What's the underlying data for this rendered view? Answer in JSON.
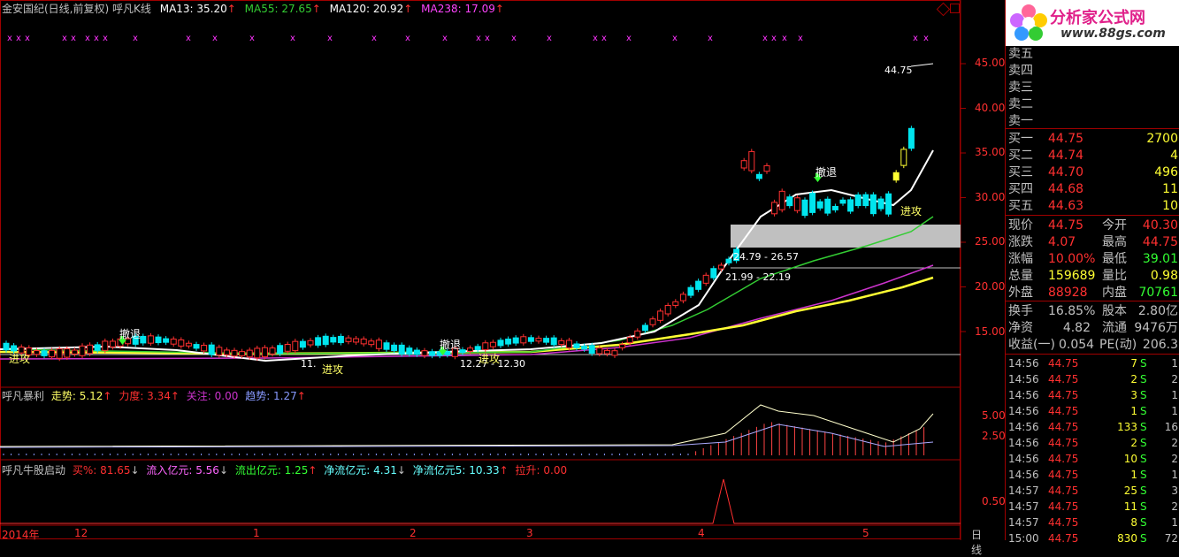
{
  "title_bar": {
    "stock": "金安国纪(日线,前复权)",
    "indicator": "呼凡K线",
    "ma13": "MA13: 35.20",
    "ma55": "MA55: 27.65",
    "ma120": "MA120: 20.92",
    "ma238": "MA238: 17.09",
    "arrow": "↑"
  },
  "colors": {
    "up": "#ff3030",
    "down": "#00e5ee",
    "ma13": "#ffffff",
    "ma55": "#33cc33",
    "ma120": "#ffff33",
    "ma238": "#cc33cc",
    "grid": "#a00000"
  },
  "price_axis": [
    "45.00",
    "40.00",
    "35.00",
    "30.00",
    "25.00",
    "20.00",
    "15.00"
  ],
  "price_labels": {
    "high": "44.75",
    "zone1": "24.79 - 26.57",
    "zone2": "21.99 - 22.19",
    "zone3": "12.27 - 12.30",
    "zone4": "11."
  },
  "signals": {
    "retreat": "撤退",
    "attack": "进攻"
  },
  "panel2": {
    "name": "呼凡暴利",
    "trend": "走势: 5.12",
    "power": "力度: 3.34",
    "focus": "关注: 0.00",
    "tendency": "趋势: 1.27",
    "axis": [
      "5.00",
      "2.50"
    ]
  },
  "panel3": {
    "name": "呼凡牛股启动",
    "buy_pct": "买%: 81.65",
    "inflow": "流入亿元: 5.56",
    "outflow": "流出亿元: 1.25",
    "net": "净流亿元: 4.31",
    "net5": "净流亿元5: 10.33",
    "lift": "拉升: 0.00",
    "axis": [
      "0.50"
    ]
  },
  "x_axis": [
    "2014年",
    "12",
    "1",
    "2",
    "3",
    "4",
    "5"
  ],
  "period_label": "日线",
  "logo": {
    "name": "分析家公式网",
    "url": "www.88gs.com"
  },
  "order_book": {
    "sells": [
      {
        "label": "卖五",
        "price": "",
        "vol": ""
      },
      {
        "label": "卖四",
        "price": "",
        "vol": ""
      },
      {
        "label": "卖三",
        "price": "",
        "vol": ""
      },
      {
        "label": "卖二",
        "price": "",
        "vol": ""
      },
      {
        "label": "卖一",
        "price": "",
        "vol": ""
      }
    ],
    "buys": [
      {
        "label": "买一",
        "price": "44.75",
        "vol": "2700"
      },
      {
        "label": "买二",
        "price": "44.74",
        "vol": "4"
      },
      {
        "label": "买三",
        "price": "44.70",
        "vol": "496"
      },
      {
        "label": "买四",
        "price": "44.68",
        "vol": "11"
      },
      {
        "label": "买五",
        "price": "44.63",
        "vol": "10"
      }
    ]
  },
  "quote": [
    {
      "l1": "现价",
      "v1": "44.75",
      "l2": "今开",
      "v2": "40.30"
    },
    {
      "l1": "涨跌",
      "v1": "4.07",
      "l2": "最高",
      "v2": "44.75"
    },
    {
      "l1": "涨幅",
      "v1": "10.00%",
      "l2": "最低",
      "v2": "39.01"
    },
    {
      "l1": "总量",
      "v1": "159689",
      "l2": "量比",
      "v2": "0.98"
    },
    {
      "l1": "外盘",
      "v1": "88928",
      "l2": "内盘",
      "v2": "70761"
    }
  ],
  "fundamentals": [
    {
      "l1": "换手",
      "v1": "16.85%",
      "l2": "股本",
      "v2": "2.80亿"
    },
    {
      "l1": "净资",
      "v1": "4.82",
      "l2": "流通",
      "v2": "9476万"
    },
    {
      "l1": "收益(一)",
      "v1": "0.054",
      "l2": "PE(动)",
      "v2": "206.3"
    }
  ],
  "ticks": [
    {
      "time": "14:56",
      "price": "44.75",
      "vol": "7",
      "side": "S",
      "n": "1"
    },
    {
      "time": "14:56",
      "price": "44.75",
      "vol": "2",
      "side": "S",
      "n": "2"
    },
    {
      "time": "14:56",
      "price": "44.75",
      "vol": "3",
      "side": "S",
      "n": "1"
    },
    {
      "time": "14:56",
      "price": "44.75",
      "vol": "1",
      "side": "S",
      "n": "1"
    },
    {
      "time": "14:56",
      "price": "44.75",
      "vol": "133",
      "side": "S",
      "n": "16"
    },
    {
      "time": "14:56",
      "price": "44.75",
      "vol": "2",
      "side": "S",
      "n": "2"
    },
    {
      "time": "14:56",
      "price": "44.75",
      "vol": "10",
      "side": "S",
      "n": "2"
    },
    {
      "time": "14:56",
      "price": "44.75",
      "vol": "1",
      "side": "S",
      "n": "1"
    },
    {
      "time": "14:57",
      "price": "44.75",
      "vol": "25",
      "side": "S",
      "n": "3"
    },
    {
      "time": "14:57",
      "price": "44.75",
      "vol": "11",
      "side": "S",
      "n": "2"
    },
    {
      "time": "14:57",
      "price": "44.75",
      "vol": "8",
      "side": "S",
      "n": "1"
    },
    {
      "time": "15:00",
      "price": "44.75",
      "vol": "830",
      "side": "S",
      "n": "72"
    }
  ]
}
